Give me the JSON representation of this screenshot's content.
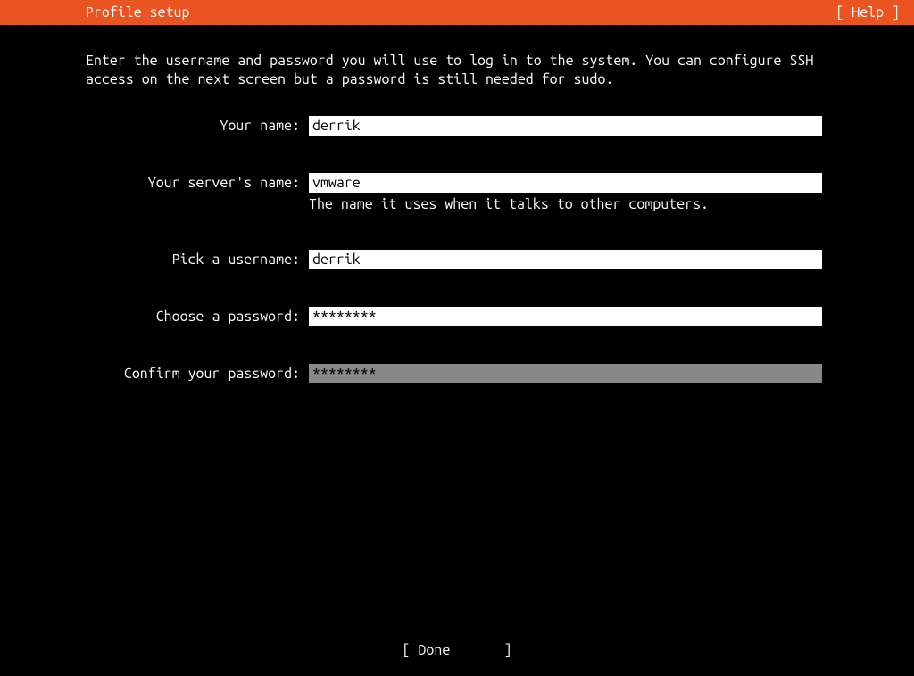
{
  "header": {
    "title": "Profile setup",
    "help": "[ Help ]"
  },
  "instructions": "Enter the username and password you will use to log in to the system. You can configure SSH access on the next screen but a password is still needed for sudo.",
  "fields": {
    "name": {
      "label": "Your name:",
      "value": "derrik"
    },
    "server": {
      "label": "Your server's name:",
      "value": "vmware",
      "hint": "The name it uses when it talks to other computers."
    },
    "username": {
      "label": "Pick a username:",
      "value": "derrik"
    },
    "password": {
      "label": "Choose a password:",
      "value": "********"
    },
    "confirm": {
      "label": "Confirm your password:",
      "value": "********"
    }
  },
  "footer": {
    "done_left": "[ ",
    "done_text": "Done",
    "done_right": "]"
  }
}
